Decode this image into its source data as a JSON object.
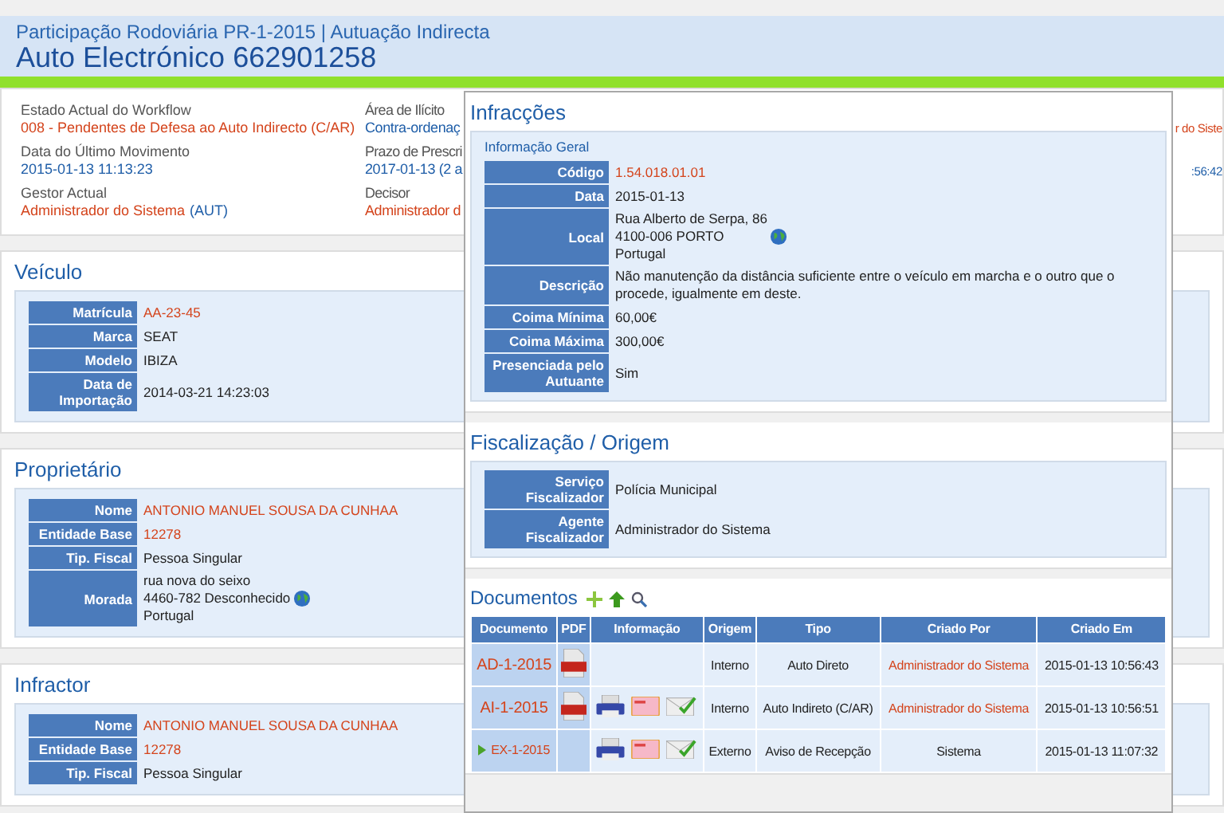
{
  "header": {
    "subtitle": "Participação Rodoviária PR-1-2015 | Autuação Indirecta",
    "title": "Auto Electrónico 662901258"
  },
  "summary": [
    {
      "items": [
        {
          "label": "Estado Actual do Workflow",
          "parts": [
            {
              "text": "008 - Pendentes de Defesa ao Auto Indirecto (C/AR)",
              "color": "#d4441c"
            }
          ]
        },
        {
          "label": "Data do Último Movimento",
          "parts": [
            {
              "text": "2015-01-13 11:13:23",
              "color": "#1f5ea8"
            }
          ]
        },
        {
          "label": "Gestor Actual",
          "parts": [
            {
              "text": "Administrador do Sistema",
              "color": "#d4441c"
            },
            {
              "text": "(AUT)",
              "color": "#1f5ea8"
            }
          ]
        }
      ]
    },
    {
      "items": [
        {
          "label": "Área de Ilícito",
          "parts": [
            {
              "text": "Contra-ordenaç",
              "color": "#1f5ea8"
            }
          ]
        },
        {
          "label": "Prazo de Prescri",
          "parts": [
            {
              "text": "2017-01-13 (2 a",
              "color": "#1f5ea8"
            }
          ]
        },
        {
          "label": "Decisor",
          "parts": [
            {
              "text": "Administrador d",
              "color": "#d4441c"
            }
          ]
        }
      ]
    },
    {
      "items": [
        {
          "parts": [
            {
              "text": "r do Siste",
              "color": "#d4441c"
            }
          ]
        },
        {
          "parts": [
            {
              "text": ":56:42",
              "color": "#1f5ea8"
            }
          ]
        }
      ]
    }
  ],
  "sections": [
    {
      "title": "Veículo",
      "fields": [
        {
          "label": "Matrícula",
          "kind": "link",
          "lines": [
            "AA-23-45"
          ]
        },
        {
          "label": "Marca",
          "kind": "text",
          "lines": [
            "SEAT"
          ]
        },
        {
          "label": "Modelo",
          "kind": "text",
          "lines": [
            "IBIZA"
          ]
        },
        {
          "label": "Data de Importação",
          "kind": "text",
          "lines": [
            "2014-03-21 14:23:03"
          ]
        }
      ]
    },
    {
      "title": "Proprietário",
      "fields": [
        {
          "label": "Nome",
          "kind": "link",
          "lines": [
            "ANTONIO MANUEL SOUSA DA CUNHAA"
          ]
        },
        {
          "label": "Entidade Base",
          "kind": "link",
          "lines": [
            "12278"
          ]
        },
        {
          "label": "Tip. Fiscal",
          "kind": "text",
          "lines": [
            "Pessoa Singular"
          ]
        },
        {
          "label": "Morada",
          "kind": "address",
          "lines": [
            "rua nova do seixo",
            "4460-782 Desconhecido",
            "Portugal"
          ]
        }
      ]
    },
    {
      "title": "Infractor",
      "fields": [
        {
          "label": "Nome",
          "kind": "link",
          "lines": [
            "ANTONIO MANUEL SOUSA DA CUNHAA"
          ]
        },
        {
          "label": "Entidade Base",
          "kind": "link",
          "lines": [
            "12278"
          ]
        },
        {
          "label": "Tip. Fiscal",
          "kind": "text",
          "lines": [
            "Pessoa Singular"
          ]
        }
      ]
    }
  ],
  "dialog": {
    "infraccoes": {
      "title": "Infracções",
      "subtitle": "Informação Geral",
      "fields": [
        {
          "label": "Código",
          "kind": "link",
          "lines": [
            "1.54.018.01.01"
          ]
        },
        {
          "label": "Data",
          "kind": "text",
          "lines": [
            "2015-01-13"
          ]
        },
        {
          "label": "Local",
          "kind": "address",
          "lines": [
            "Rua Alberto de Serpa, 86",
            "4100-006 PORTO",
            "Portugal"
          ]
        },
        {
          "label": "Descrição",
          "kind": "text",
          "lines": [
            "Não manutenção da distância suficiente entre o veículo em marcha e o outro que o procede, igualmente em deste."
          ]
        },
        {
          "label": "Coima Mínima",
          "kind": "text",
          "lines": [
            "60,00€"
          ]
        },
        {
          "label": "Coima Máxima",
          "kind": "text",
          "lines": [
            "300,00€"
          ]
        },
        {
          "label": "Presenciada pelo Autuante",
          "kind": "text",
          "lines": [
            "Sim"
          ]
        }
      ]
    },
    "fiscalizacao": {
      "title": "Fiscalização / Origem",
      "fields": [
        {
          "label": "Serviço Fiscalizador",
          "kind": "text",
          "lines": [
            "Polícia Municipal"
          ]
        },
        {
          "label": "Agente Fiscalizador",
          "kind": "text",
          "lines": [
            "Administrador do Sistema"
          ]
        }
      ]
    },
    "documentos": {
      "title": "Documentos",
      "columns": [
        "Documento",
        "PDF",
        "Informação",
        "Origem",
        "Tipo",
        "Criado Por",
        "Criado Em"
      ],
      "rows": [
        {
          "documento": "AD-1-2015",
          "expandable": false,
          "pdf": true,
          "info_icons": false,
          "origem": "Interno",
          "tipo": "Auto Direto",
          "criado_por": "Administrador do Sistema",
          "criado_por_link": true,
          "criado_em": "2015-01-13 10:56:43"
        },
        {
          "documento": "AI-1-2015",
          "expandable": false,
          "pdf": true,
          "info_icons": true,
          "origem": "Interno",
          "tipo": "Auto Indireto (C/AR)",
          "criado_por": "Administrador do Sistema",
          "criado_por_link": true,
          "criado_em": "2015-01-13 10:56:51"
        },
        {
          "documento": "EX-1-2015",
          "expandable": true,
          "pdf": false,
          "info_icons": true,
          "origem": "Externo",
          "tipo": "Aviso de Recepção",
          "criado_por": "Sistema",
          "criado_por_link": false,
          "criado_em": "2015-01-13 11:07:32"
        }
      ]
    }
  }
}
